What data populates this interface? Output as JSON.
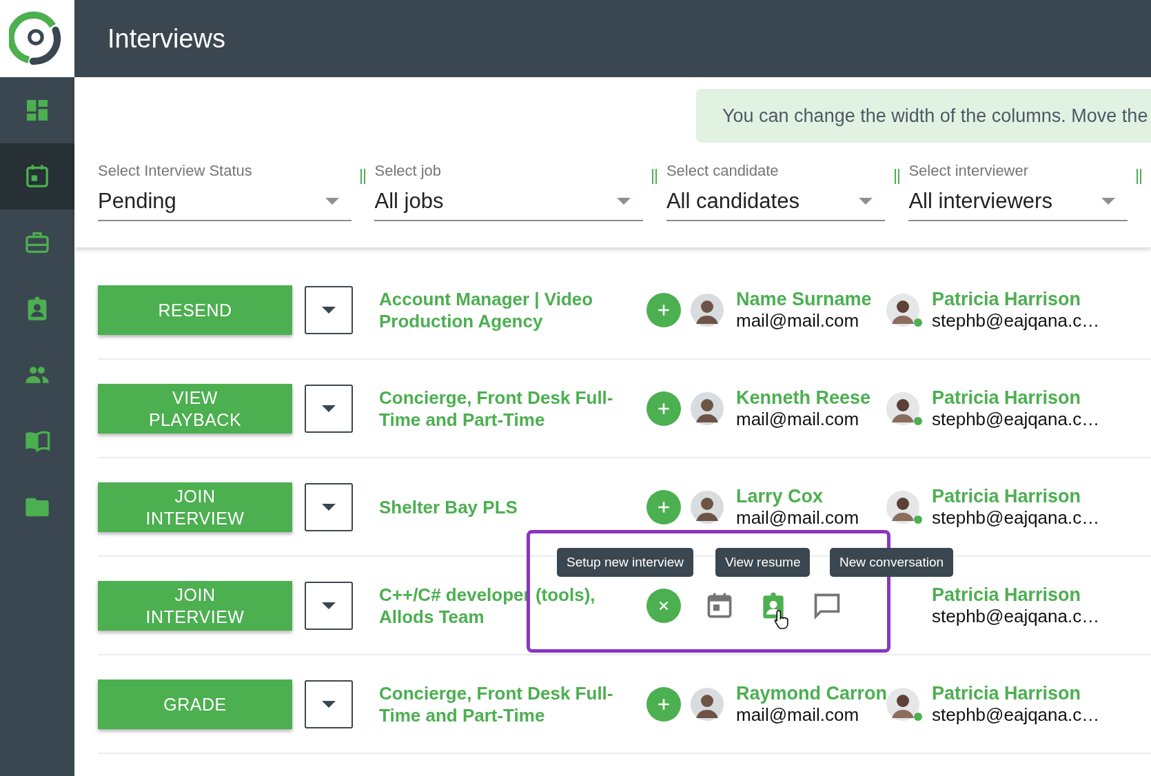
{
  "header": {
    "title": "Interviews"
  },
  "sidebar": {
    "items": [
      {
        "kind": "dashboard",
        "selected": false
      },
      {
        "kind": "calendar",
        "selected": true
      },
      {
        "kind": "briefcase",
        "selected": false
      },
      {
        "kind": "badge",
        "selected": false
      },
      {
        "kind": "people",
        "selected": false
      },
      {
        "kind": "book",
        "selected": false
      },
      {
        "kind": "folder",
        "selected": false
      }
    ]
  },
  "tip": "You can change the width of the columns. Move the",
  "filters": [
    {
      "label": "Select Interview Status",
      "value": "Pending"
    },
    {
      "label": "Select job",
      "value": "All jobs"
    },
    {
      "label": "Select candidate",
      "value": "All candidates"
    },
    {
      "label": "Select interviewer",
      "value": "All interviewers"
    }
  ],
  "rows": [
    {
      "action": "RESEND",
      "job": "Account Manager | Video Production Agency",
      "candidate": {
        "name": "Name Surname",
        "email": "mail@mail.com"
      },
      "interviewer": {
        "name": "Patricia Harrison",
        "email": "stephb@eajqana.c…",
        "online": true
      }
    },
    {
      "action": "VIEW PLAYBACK",
      "job": "Concierge, Front Desk Full-Time and Part-Time",
      "candidate": {
        "name": "Kenneth Reese",
        "email": "mail@mail.com"
      },
      "interviewer": {
        "name": "Patricia Harrison",
        "email": "stephb@eajqana.c…",
        "online": true
      }
    },
    {
      "action": "JOIN INTERVIEW",
      "job": "Shelter Bay PLS",
      "candidate": {
        "name": "Larry Cox",
        "email": "mail@mail.com"
      },
      "interviewer": {
        "name": "Patricia Harrison",
        "email": "stephb@eajqana.c…",
        "online": true
      }
    },
    {
      "action": "JOIN INTERVIEW",
      "job": "C++/C# developer (tools), Allods Team",
      "actions": [
        {
          "kind": "calendar",
          "tooltip": "Setup new interview",
          "active": false
        },
        {
          "kind": "resume",
          "tooltip": "View resume",
          "active": true
        },
        {
          "kind": "chat",
          "tooltip": "New conversation",
          "active": false
        }
      ],
      "interviewer": {
        "name": "Patricia Harrison",
        "email": "stephb@eajqana.c…"
      }
    },
    {
      "action": "GRADE",
      "job": "Concierge, Front Desk Full-Time and Part-Time",
      "candidate": {
        "name": "Raymond Carron",
        "email": "mail@mail.com"
      },
      "interviewer": {
        "name": "Patricia Harrison",
        "email": "stephb@eajqana.c…",
        "online": true
      }
    }
  ]
}
